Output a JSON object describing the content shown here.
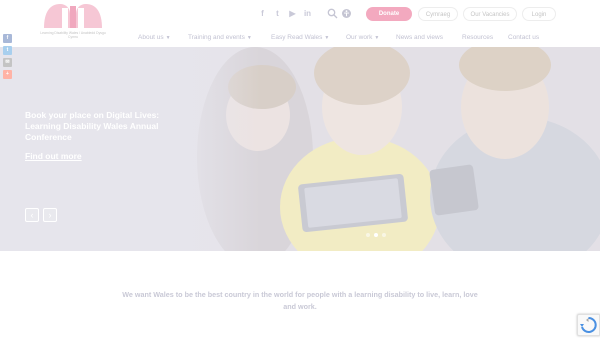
{
  "header": {
    "logo_text": "Learning Disability Wales / Anabledd Dysgu Cymru",
    "social_icons": [
      "facebook-icon",
      "twitter-icon",
      "youtube-icon",
      "linkedin-icon"
    ],
    "donate_label": "Donate",
    "top_links": [
      "Cymraeg",
      "Our Vacancies",
      "Login"
    ],
    "nav": [
      {
        "label": "About us",
        "dropdown": true
      },
      {
        "label": "Training and events",
        "dropdown": true
      },
      {
        "label": "Easy Read Wales",
        "dropdown": true
      },
      {
        "label": "Our work",
        "dropdown": true
      },
      {
        "label": "News and views",
        "dropdown": false
      },
      {
        "label": "Resources",
        "dropdown": false
      },
      {
        "label": "Contact us",
        "dropdown": false
      }
    ]
  },
  "share_bar": {
    "icons": [
      "facebook-icon",
      "twitter-icon",
      "email-icon",
      "share-plus-icon"
    ],
    "colors": [
      "#4a6fb5",
      "#4aa3df",
      "#8f8f8f",
      "#ff6550"
    ]
  },
  "hero": {
    "title": "Book your place on Digital Lives: Learning Disability Wales Annual Conference",
    "link_label": "Find out more",
    "prev_label": "‹",
    "next_label": "›",
    "slides_count": 3,
    "active_slide": 1
  },
  "mission": {
    "text": "We want Wales to be the best country in the world for people with a learning disability to live, learn, love and work."
  },
  "colors": {
    "accent": "#f3a9bf",
    "nav_text": "#c2c2d2",
    "hero_bg": "#e9e8ee"
  }
}
